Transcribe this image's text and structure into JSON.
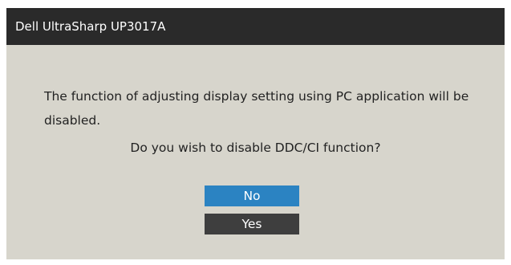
{
  "window": {
    "title": "Dell UltraSharp UP3017A"
  },
  "dialog": {
    "message": "The function of adjusting display setting using PC application will be disabled.",
    "question": "Do you wish to disable DDC/CI function?",
    "buttons": {
      "no_label": "No",
      "yes_label": "Yes"
    }
  },
  "colors": {
    "titlebar": "#2a2a2a",
    "panel": "#d7d5cc",
    "selected_button": "#2b83c2",
    "unselected_button": "#3e3e3e"
  }
}
